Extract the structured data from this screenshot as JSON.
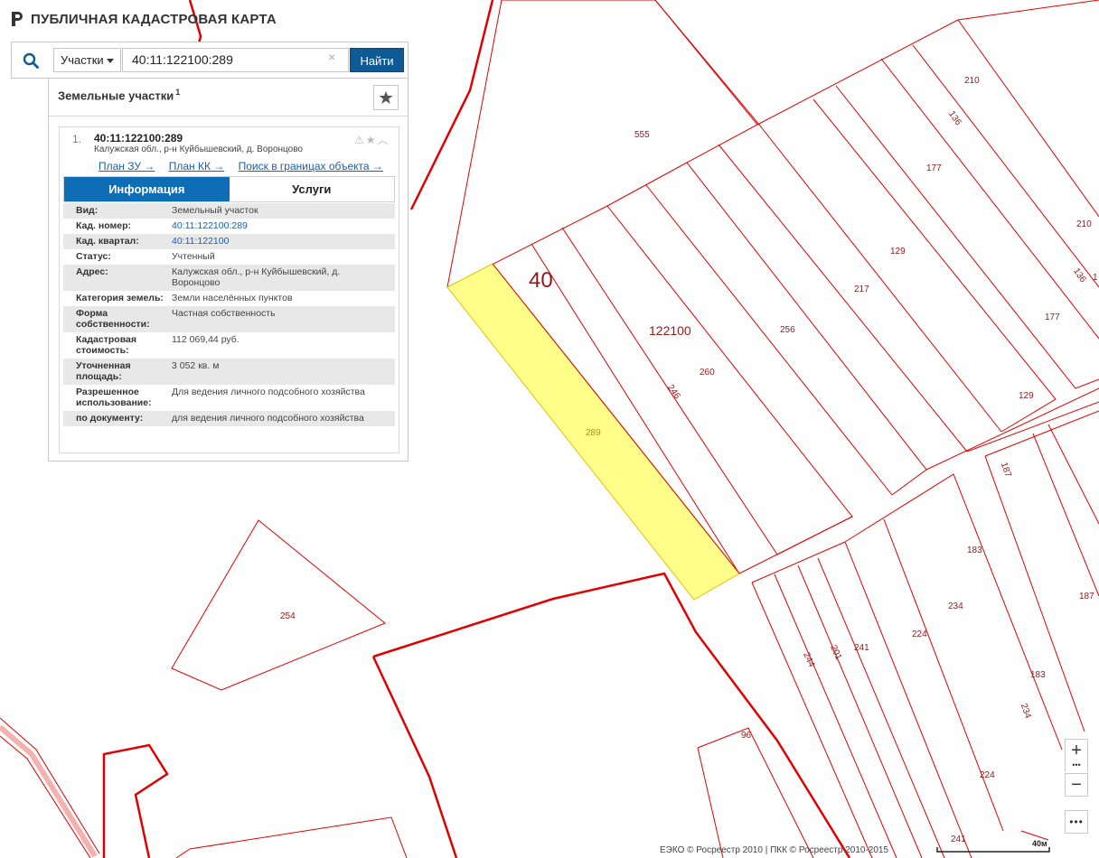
{
  "app": {
    "title": "ПУБЛИЧНАЯ КАДАСТРОВАЯ КАРТА"
  },
  "search": {
    "type_label": "Участки",
    "query": "40:11:122100:289",
    "clear_glyph": "×",
    "find_label": "Найти"
  },
  "panel": {
    "title": "Земельные участки",
    "count": "1",
    "result": {
      "num": "1.",
      "cad_number": "40:11:122100:289",
      "address": "Калужская обл., р-н Куйбышевский, д. Воронцово",
      "links": [
        "План ЗУ →",
        "План КК →",
        "Поиск в границах объекта →"
      ]
    },
    "tabs": [
      "Информация",
      "Услуги"
    ],
    "info": [
      {
        "k": "Вид:",
        "v": "Земельный участок",
        "link": false
      },
      {
        "k": "Кад. номер:",
        "v": "40:11:122100:289",
        "link": true
      },
      {
        "k": "Кад. квартал:",
        "v": "40:11:122100",
        "link": true
      },
      {
        "k": "Статус:",
        "v": "Учтенный",
        "link": false
      },
      {
        "k": "Адрес:",
        "v": "Калужская обл., р-н Куйбышевский, д. Воронцово",
        "link": false
      },
      {
        "k": "Категория земель:",
        "v": "Земли населённых пунктов",
        "link": false
      },
      {
        "k": "Форма собственности:",
        "v": "Частная собственность",
        "link": false
      },
      {
        "k": "Кадастровая стоимость:",
        "v": "112 069,44 руб.",
        "link": false
      },
      {
        "k": "Уточненная площадь:",
        "v": "3 052 кв. м",
        "link": false
      },
      {
        "k": "Разрешенное использование:",
        "v": "Для ведения личного подсобного хозяйства",
        "link": false
      },
      {
        "k": "по документу:",
        "v": "для ведения личного подсобного хозяйства",
        "link": false
      }
    ]
  },
  "map": {
    "district_label": "40",
    "quarter_label": "122100",
    "selected_parcel": "289",
    "parcel_labels": [
      "555",
      "210",
      "136",
      "177",
      "210",
      "136",
      "1",
      "129",
      "217",
      "256",
      "260",
      "246",
      "177",
      "129",
      "187",
      "183",
      "187",
      "234",
      "224",
      "183",
      "241",
      "201",
      "244",
      "234",
      "224",
      "96",
      "241",
      "254"
    ],
    "colors": {
      "boundary": "#e00000",
      "selected_fill": "#ffff8a",
      "selected_stroke": "#e6c200"
    }
  },
  "controls": {
    "zoom_in": "+",
    "zoom_dots": "•••",
    "zoom_out": "−",
    "more": "•••"
  },
  "footer": {
    "copyright": "ЕЭКО © Росреестр 2010 | ПКК © Росреестр 2010-2015",
    "scale": "40м"
  }
}
